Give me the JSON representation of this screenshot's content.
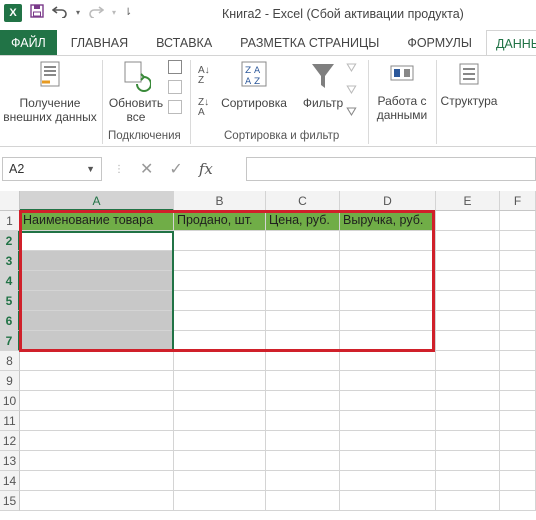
{
  "window": {
    "title": "Книга2 - Excel (Сбой активации продукта)",
    "app_logo": "X"
  },
  "tabs": [
    {
      "label": "ФАЙЛ"
    },
    {
      "label": "ГЛАВНАЯ"
    },
    {
      "label": "ВСТАВКА"
    },
    {
      "label": "РАЗМЕТКА СТРАНИЦЫ"
    },
    {
      "label": "ФОРМУЛЫ"
    },
    {
      "label": "ДАННЫЕ"
    }
  ],
  "ribbon": {
    "get_data_label": "Получение внешних данных",
    "refresh_all_label": "Обновить все",
    "connections_group": "Подключения",
    "sort_label": "Сортировка",
    "filter_label": "Фильтр",
    "sort_filter_group": "Сортировка и фильтр",
    "data_tools_label": "Работа с данными",
    "outline_label": "Структура"
  },
  "formula_bar": {
    "name_box": "A2",
    "fx": "fx",
    "value": ""
  },
  "grid": {
    "columns": [
      "A",
      "B",
      "C",
      "D",
      "E",
      "F"
    ],
    "rows": [
      "1",
      "2",
      "3",
      "4",
      "5",
      "6",
      "7",
      "8",
      "9",
      "10",
      "11",
      "12",
      "13",
      "14",
      "15"
    ],
    "header_cells": {
      "A1": "Наименование товара",
      "B1": "Продано, шт.",
      "C1": "Цена, руб.",
      "D1": "Выручка, руб."
    },
    "active_cell": "A2",
    "selection": "A2:A7"
  },
  "colors": {
    "accent": "#217346",
    "header_fill": "#70ad47",
    "selection_fill": "#c8c8c8",
    "highlight_border": "#d0202a"
  }
}
